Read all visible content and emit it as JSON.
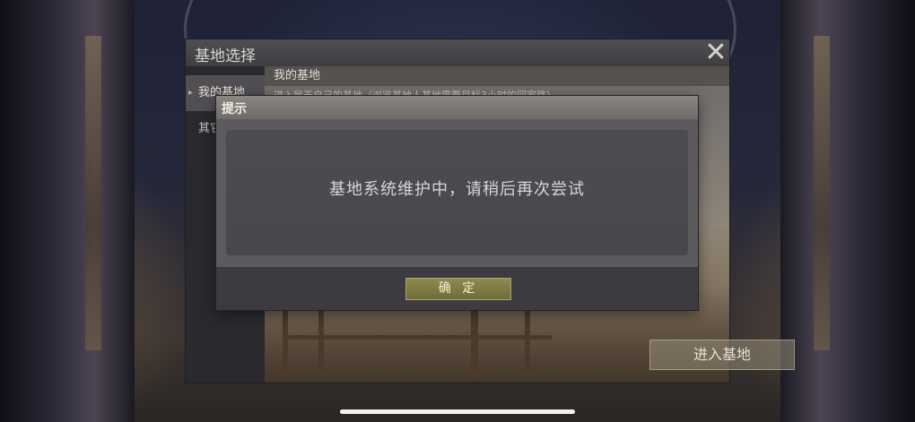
{
  "base_window": {
    "title": "基地选择",
    "close_symbol": "✕",
    "sidebar": {
      "items": [
        {
          "label": "我的基地",
          "active": true
        },
        {
          "label": "其它",
          "active": false
        }
      ]
    },
    "main": {
      "header": "我的基地",
      "description": "进入属于自己的基地（浏览基地人基地需要目标3小时的回家路）",
      "enter_button": "进入基地"
    }
  },
  "dialog": {
    "title": "提示",
    "message": "基地系统维护中，请稍后再次尝试",
    "confirm_button": "确 定"
  },
  "colors": {
    "dialog_header": "#7d7a76",
    "confirm_button": "#7e7c42",
    "panel": "#3d3b3f"
  }
}
